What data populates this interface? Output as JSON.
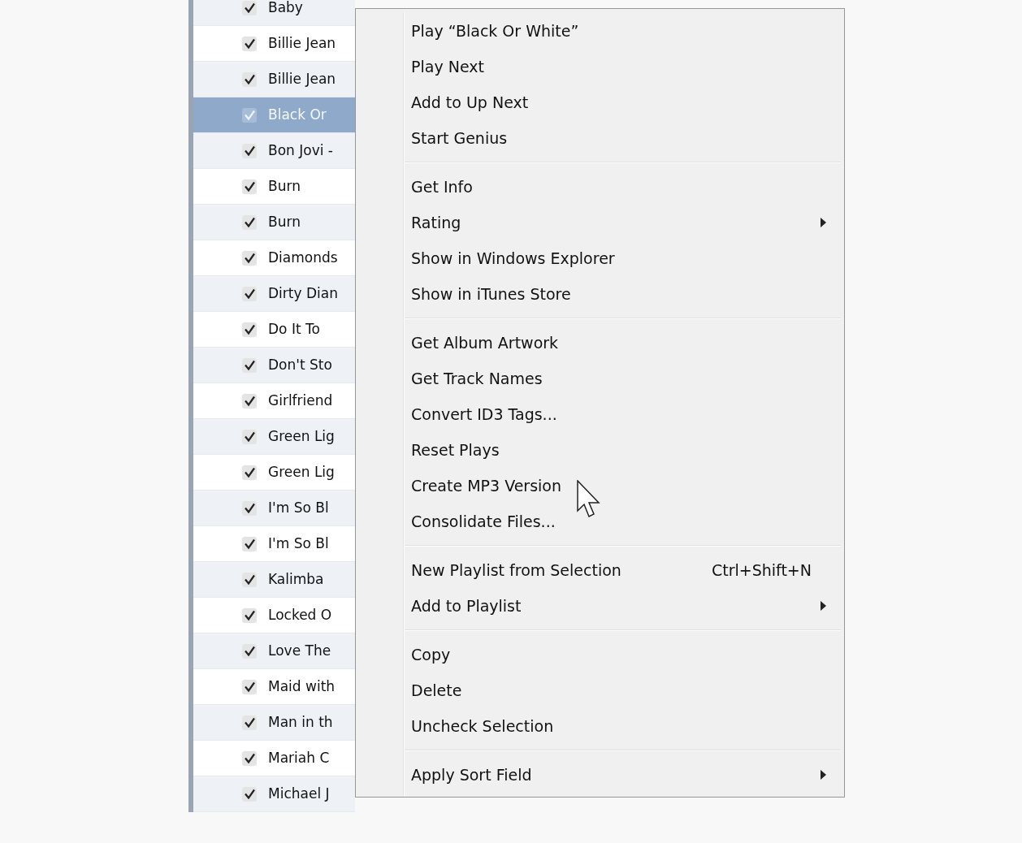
{
  "tracks": [
    {
      "title": "Baby",
      "checked": true,
      "selected": false
    },
    {
      "title": "Billie Jean",
      "checked": true,
      "selected": false
    },
    {
      "title": "Billie Jean",
      "checked": true,
      "selected": false
    },
    {
      "title": "Black Or",
      "checked": true,
      "selected": true
    },
    {
      "title": "Bon Jovi -",
      "checked": true,
      "selected": false
    },
    {
      "title": "Burn",
      "checked": true,
      "selected": false
    },
    {
      "title": "Burn",
      "checked": true,
      "selected": false
    },
    {
      "title": "Diamonds",
      "checked": true,
      "selected": false
    },
    {
      "title": "Dirty Dian",
      "checked": true,
      "selected": false
    },
    {
      "title": "Do It To",
      "checked": true,
      "selected": false
    },
    {
      "title": "Don't Sto",
      "checked": true,
      "selected": false
    },
    {
      "title": "Girlfriend",
      "checked": true,
      "selected": false
    },
    {
      "title": "Green Lig",
      "checked": true,
      "selected": false
    },
    {
      "title": "Green Lig",
      "checked": true,
      "selected": false
    },
    {
      "title": "I'm So Bl",
      "checked": true,
      "selected": false
    },
    {
      "title": "I'm So Bl",
      "checked": true,
      "selected": false
    },
    {
      "title": "Kalimba",
      "checked": true,
      "selected": false
    },
    {
      "title": "Locked O",
      "checked": true,
      "selected": false
    },
    {
      "title": "Love The",
      "checked": true,
      "selected": false
    },
    {
      "title": "Maid with",
      "checked": true,
      "selected": false
    },
    {
      "title": "Man in th",
      "checked": true,
      "selected": false
    },
    {
      "title": "Mariah C",
      "checked": true,
      "selected": false
    },
    {
      "title": "Michael J",
      "checked": true,
      "selected": false
    }
  ],
  "context_menu": {
    "groups": [
      [
        {
          "label": "Play “Black Or White”",
          "submenu": false
        },
        {
          "label": "Play Next",
          "submenu": false
        },
        {
          "label": "Add to Up Next",
          "submenu": false
        },
        {
          "label": "Start Genius",
          "submenu": false
        }
      ],
      [
        {
          "label": "Get Info",
          "submenu": false
        },
        {
          "label": "Rating",
          "submenu": true
        },
        {
          "label": "Show in Windows Explorer",
          "submenu": false
        },
        {
          "label": "Show in iTunes Store",
          "submenu": false
        }
      ],
      [
        {
          "label": "Get Album Artwork",
          "submenu": false
        },
        {
          "label": "Get Track Names",
          "submenu": false
        },
        {
          "label": "Convert ID3 Tags...",
          "submenu": false
        },
        {
          "label": "Reset Plays",
          "submenu": false
        },
        {
          "label": "Create MP3 Version",
          "submenu": false
        },
        {
          "label": "Consolidate Files...",
          "submenu": false
        }
      ],
      [
        {
          "label": "New Playlist from Selection",
          "shortcut": "Ctrl+Shift+N",
          "submenu": false
        },
        {
          "label": "Add to Playlist",
          "submenu": true
        }
      ],
      [
        {
          "label": "Copy",
          "submenu": false
        },
        {
          "label": "Delete",
          "submenu": false
        },
        {
          "label": "Uncheck Selection",
          "submenu": false
        }
      ],
      [
        {
          "label": "Apply Sort Field",
          "submenu": true
        }
      ]
    ]
  }
}
